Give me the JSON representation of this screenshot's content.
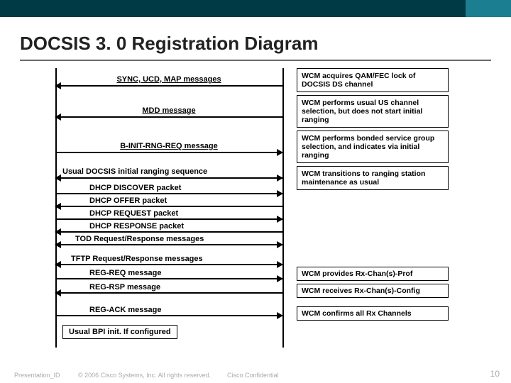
{
  "header": {
    "title": "DOCSIS 3. 0 Registration Diagram"
  },
  "messages": {
    "m1": "SYNC, UCD, MAP messages",
    "m2": "MDD message",
    "m3": "B-INIT-RNG-REQ message",
    "m4": "Usual DOCSIS initial ranging sequence",
    "m5": "DHCP DISCOVER  packet",
    "m6": "DHCP OFFER packet",
    "m7": "DHCP REQUEST packet",
    "m8": "DHCP RESPONSE packet",
    "m9": "TOD Request/Response messages",
    "m10": "TFTP Request/Response messages",
    "m11": "REG-REQ message",
    "m12": "REG-RSP message",
    "m13": "REG-ACK message",
    "m14": "Usual BPI init. If configured"
  },
  "notes": {
    "n1": "WCM acquires QAM/FEC lock of DOCSIS DS channel",
    "n2": "WCM performs usual US channel selection, but does not start initial ranging",
    "n3": "WCM performs bonded service group selection, and indicates via initial ranging",
    "n4": "WCM transitions to ranging station maintenance as usual",
    "n5": "WCM provides Rx-Chan(s)-Prof",
    "n6": "WCM receives Rx-Chan(s)-Config",
    "n7": "WCM confirms all Rx Channels"
  },
  "footer": {
    "presentation_id": "Presentation_ID",
    "copyright": "© 2006 Cisco Systems, Inc. All rights reserved.",
    "confidential": "Cisco Confidential",
    "page": "10"
  }
}
